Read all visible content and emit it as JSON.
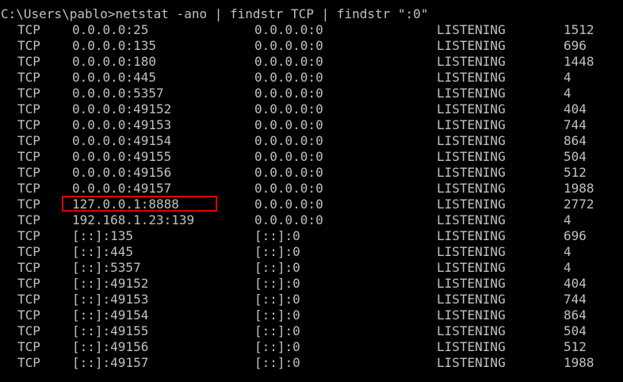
{
  "window": {
    "prompt": "C:\\Users\\pablo>netstat -ano | findstr TCP | findstr \":0\"",
    "highlight_color": "#e00000",
    "background_color": "#000000",
    "text_color": "#c0c0c0"
  },
  "rows": [
    {
      "proto": "TCP",
      "local": "0.0.0.0:25",
      "foreign": "0.0.0.0:0",
      "state": "LISTENING",
      "pid": "1512"
    },
    {
      "proto": "TCP",
      "local": "0.0.0.0:135",
      "foreign": "0.0.0.0:0",
      "state": "LISTENING",
      "pid": "696"
    },
    {
      "proto": "TCP",
      "local": "0.0.0.0:180",
      "foreign": "0.0.0.0:0",
      "state": "LISTENING",
      "pid": "1448"
    },
    {
      "proto": "TCP",
      "local": "0.0.0.0:445",
      "foreign": "0.0.0.0:0",
      "state": "LISTENING",
      "pid": "4"
    },
    {
      "proto": "TCP",
      "local": "0.0.0.0:5357",
      "foreign": "0.0.0.0:0",
      "state": "LISTENING",
      "pid": "4"
    },
    {
      "proto": "TCP",
      "local": "0.0.0.0:49152",
      "foreign": "0.0.0.0:0",
      "state": "LISTENING",
      "pid": "404"
    },
    {
      "proto": "TCP",
      "local": "0.0.0.0:49153",
      "foreign": "0.0.0.0:0",
      "state": "LISTENING",
      "pid": "744"
    },
    {
      "proto": "TCP",
      "local": "0.0.0.0:49154",
      "foreign": "0.0.0.0:0",
      "state": "LISTENING",
      "pid": "864"
    },
    {
      "proto": "TCP",
      "local": "0.0.0.0:49155",
      "foreign": "0.0.0.0:0",
      "state": "LISTENING",
      "pid": "504"
    },
    {
      "proto": "TCP",
      "local": "0.0.0.0:49156",
      "foreign": "0.0.0.0:0",
      "state": "LISTENING",
      "pid": "512"
    },
    {
      "proto": "TCP",
      "local": "0.0.0.0:49157",
      "foreign": "0.0.0.0:0",
      "state": "LISTENING",
      "pid": "1988"
    },
    {
      "proto": "TCP",
      "local": "127.0.0.1:8888",
      "foreign": "0.0.0.0:0",
      "state": "LISTENING",
      "pid": "2772"
    },
    {
      "proto": "TCP",
      "local": "192.168.1.23:139",
      "foreign": "0.0.0.0:0",
      "state": "LISTENING",
      "pid": "4"
    },
    {
      "proto": "TCP",
      "local": "[::]:135",
      "foreign": "[::]:0",
      "state": "LISTENING",
      "pid": "696"
    },
    {
      "proto": "TCP",
      "local": "[::]:445",
      "foreign": "[::]:0",
      "state": "LISTENING",
      "pid": "4"
    },
    {
      "proto": "TCP",
      "local": "[::]:5357",
      "foreign": "[::]:0",
      "state": "LISTENING",
      "pid": "4"
    },
    {
      "proto": "TCP",
      "local": "[::]:49152",
      "foreign": "[::]:0",
      "state": "LISTENING",
      "pid": "404"
    },
    {
      "proto": "TCP",
      "local": "[::]:49153",
      "foreign": "[::]:0",
      "state": "LISTENING",
      "pid": "744"
    },
    {
      "proto": "TCP",
      "local": "[::]:49154",
      "foreign": "[::]:0",
      "state": "LISTENING",
      "pid": "864"
    },
    {
      "proto": "TCP",
      "local": "[::]:49155",
      "foreign": "[::]:0",
      "state": "LISTENING",
      "pid": "504"
    },
    {
      "proto": "TCP",
      "local": "[::]:49156",
      "foreign": "[::]:0",
      "state": "LISTENING",
      "pid": "512"
    },
    {
      "proto": "TCP",
      "local": "[::]:49157",
      "foreign": "[::]:0",
      "state": "LISTENING",
      "pid": "1988"
    }
  ]
}
